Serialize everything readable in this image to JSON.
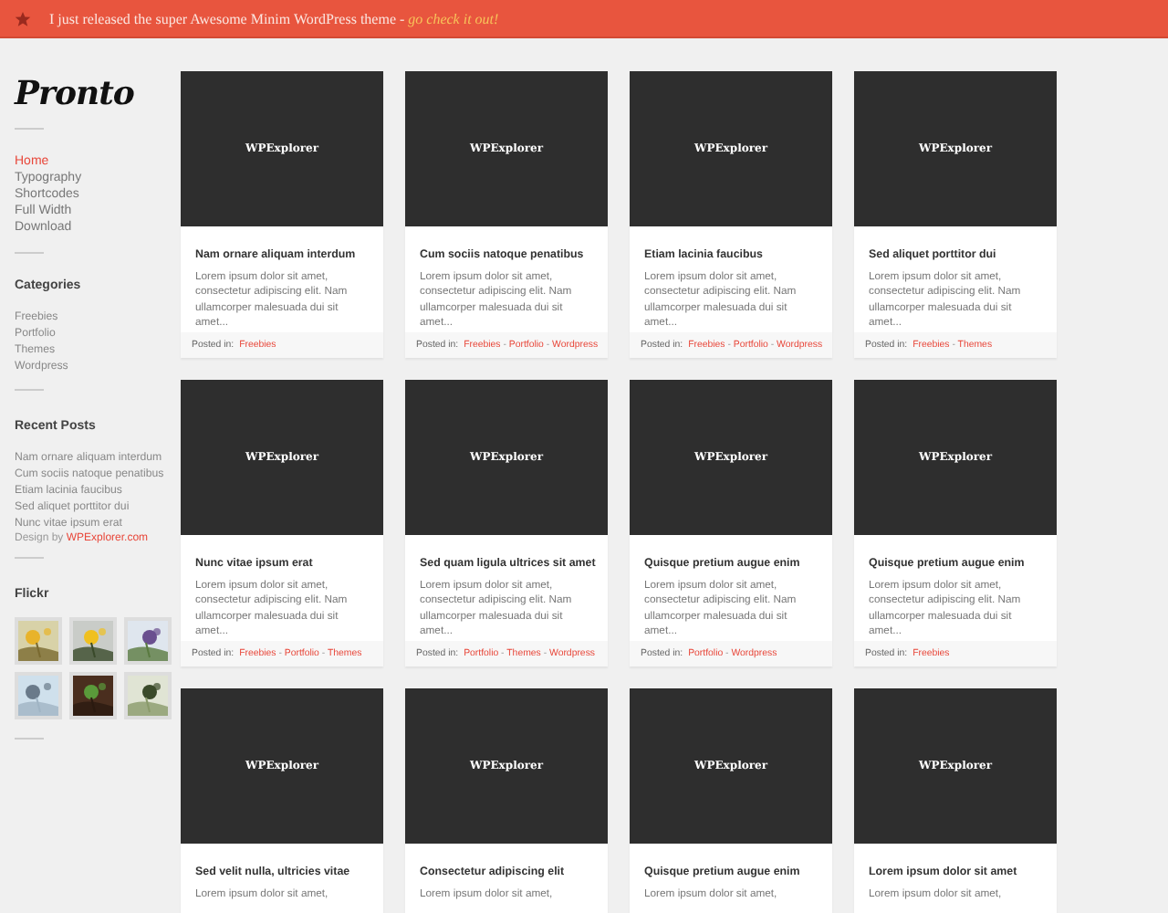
{
  "notice": {
    "text": "I just released the super Awesome Minim WordPress theme - ",
    "link": "go check it out!"
  },
  "logo": "Pronto",
  "nav": [
    {
      "label": "Home",
      "selected": true
    },
    {
      "label": "Typography",
      "selected": false
    },
    {
      "label": "Shortcodes",
      "selected": false
    },
    {
      "label": "Full Width",
      "selected": false
    },
    {
      "label": "Download",
      "selected": false
    }
  ],
  "categories": {
    "title": "Categories",
    "items": [
      "Freebies",
      "Portfolio",
      "Themes",
      "Wordpress"
    ]
  },
  "recent_posts": {
    "title": "Recent Posts",
    "items": [
      "Nam ornare aliquam interdum",
      "Cum sociis natoque penatibus",
      "Etiam lacinia faucibus",
      "Sed aliquet porttitor dui",
      "Nunc vitae ipsum erat"
    ]
  },
  "credit": {
    "text": "Design by ",
    "link": "WPExplorer.com"
  },
  "flickr": {
    "title": "Flickr"
  },
  "tag_separator": " - ",
  "posts": [
    {
      "image_label": "WPExplorer",
      "title": "Nam ornare aliquam interdum",
      "excerpt": "Lorem ipsum dolor sit amet, consectetur adipiscing elit. Nam ullamcorper malesuada dui sit amet...",
      "posted_in": "Posted in:",
      "tags": [
        "Freebies"
      ]
    },
    {
      "image_label": "WPExplorer",
      "title": "Cum sociis natoque penatibus",
      "excerpt": "Lorem ipsum dolor sit amet, consectetur adipiscing elit. Nam ullamcorper malesuada dui sit amet...",
      "posted_in": "Posted in:",
      "tags": [
        "Freebies",
        "Portfolio",
        "Wordpress"
      ]
    },
    {
      "image_label": "WPExplorer",
      "title": "Etiam lacinia faucibus",
      "excerpt": "Lorem ipsum dolor sit amet, consectetur adipiscing elit. Nam ullamcorper malesuada dui sit amet...",
      "posted_in": "Posted in:",
      "tags": [
        "Freebies",
        "Portfolio",
        "Wordpress"
      ]
    },
    {
      "image_label": "WPExplorer",
      "title": "Sed aliquet porttitor dui",
      "excerpt": "Lorem ipsum dolor sit amet, consectetur adipiscing elit. Nam ullamcorper malesuada dui sit amet...",
      "posted_in": "Posted in:",
      "tags": [
        "Freebies",
        "Themes"
      ]
    },
    {
      "image_label": "WPExplorer",
      "title": "Nunc vitae ipsum erat",
      "excerpt": "Lorem ipsum dolor sit amet, consectetur adipiscing elit. Nam ullamcorper malesuada dui sit amet...",
      "posted_in": "Posted in:",
      "tags": [
        "Freebies",
        "Portfolio",
        "Themes"
      ]
    },
    {
      "image_label": "WPExplorer",
      "title": "Sed quam ligula ultrices sit amet",
      "excerpt": "Lorem ipsum dolor sit amet, consectetur adipiscing elit. Nam ullamcorper malesuada dui sit amet...",
      "posted_in": "Posted in:",
      "tags": [
        "Portfolio",
        "Themes",
        "Wordpress"
      ]
    },
    {
      "image_label": "WPExplorer",
      "title": "Quisque pretium augue enim",
      "excerpt": "Lorem ipsum dolor sit amet, consectetur adipiscing elit. Nam ullamcorper malesuada dui sit amet...",
      "posted_in": "Posted in:",
      "tags": [
        "Portfolio",
        "Wordpress"
      ]
    },
    {
      "image_label": "WPExplorer",
      "title": "Quisque pretium augue enim",
      "excerpt": "Lorem ipsum dolor sit amet, consectetur adipiscing elit. Nam ullamcorper malesuada dui sit amet...",
      "posted_in": "Posted in:",
      "tags": [
        "Freebies"
      ]
    },
    {
      "image_label": "WPExplorer",
      "title": "Sed velit nulla, ultricies vitae",
      "excerpt": "Lorem ipsum dolor sit amet,"
    },
    {
      "image_label": "WPExplorer",
      "title": "Consectetur adipiscing elit",
      "excerpt": "Lorem ipsum dolor sit amet,"
    },
    {
      "image_label": "WPExplorer",
      "title": "Quisque pretium augue enim",
      "excerpt": "Lorem ipsum dolor sit amet,"
    },
    {
      "image_label": "WPExplorer",
      "title": "Lorem ipsum dolor sit amet",
      "excerpt": "Lorem ipsum dolor sit amet,"
    }
  ]
}
